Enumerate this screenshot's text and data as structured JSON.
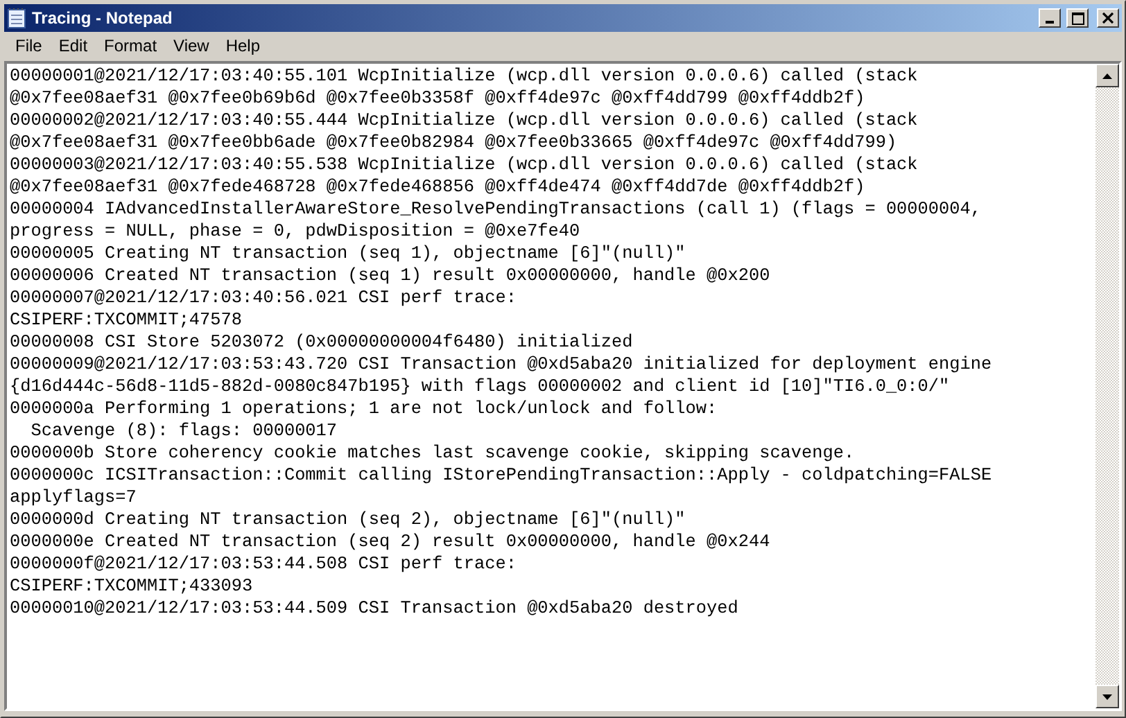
{
  "window": {
    "title": "Tracing - Notepad"
  },
  "menu": [
    {
      "label": "File"
    },
    {
      "label": "Edit"
    },
    {
      "label": "Format"
    },
    {
      "label": "View"
    },
    {
      "label": "Help"
    }
  ],
  "lines": [
    "00000001@2021/12/17:03:40:55.101 WcpInitialize (wcp.dll version 0.0.0.6) called (stack",
    "@0x7fee08aef31 @0x7fee0b69b6d @0x7fee0b3358f @0xff4de97c @0xff4dd799 @0xff4ddb2f)",
    "00000002@2021/12/17:03:40:55.444 WcpInitialize (wcp.dll version 0.0.0.6) called (stack",
    "@0x7fee08aef31 @0x7fee0bb6ade @0x7fee0b82984 @0x7fee0b33665 @0xff4de97c @0xff4dd799)",
    "00000003@2021/12/17:03:40:55.538 WcpInitialize (wcp.dll version 0.0.0.6) called (stack",
    "@0x7fee08aef31 @0x7fede468728 @0x7fede468856 @0xff4de474 @0xff4dd7de @0xff4ddb2f)",
    "00000004 IAdvancedInstallerAwareStore_ResolvePendingTransactions (call 1) (flags = 00000004,",
    "progress = NULL, phase = 0, pdwDisposition = @0xe7fe40",
    "00000005 Creating NT transaction (seq 1), objectname [6]\"(null)\"",
    "00000006 Created NT transaction (seq 1) result 0x00000000, handle @0x200",
    "00000007@2021/12/17:03:40:56.021 CSI perf trace:",
    "CSIPERF:TXCOMMIT;47578",
    "00000008 CSI Store 5203072 (0x00000000004f6480) initialized",
    "00000009@2021/12/17:03:53:43.720 CSI Transaction @0xd5aba20 initialized for deployment engine",
    "{d16d444c-56d8-11d5-882d-0080c847b195} with flags 00000002 and client id [10]\"TI6.0_0:0/\"",
    "0000000a Performing 1 operations; 1 are not lock/unlock and follow:",
    "  Scavenge (8): flags: 00000017",
    "0000000b Store coherency cookie matches last scavenge cookie, skipping scavenge.",
    "0000000c ICSITransaction::Commit calling IStorePendingTransaction::Apply - coldpatching=FALSE",
    "applyflags=7",
    "0000000d Creating NT transaction (seq 2), objectname [6]\"(null)\"",
    "0000000e Created NT transaction (seq 2) result 0x00000000, handle @0x244",
    "0000000f@2021/12/17:03:53:44.508 CSI perf trace:",
    "CSIPERF:TXCOMMIT;433093",
    "00000010@2021/12/17:03:53:44.509 CSI Transaction @0xd5aba20 destroyed"
  ]
}
